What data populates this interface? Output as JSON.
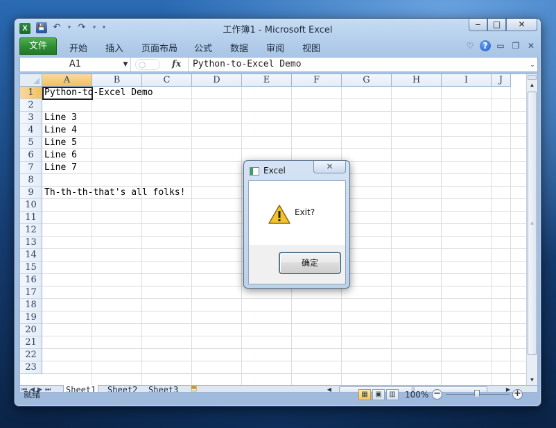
{
  "window": {
    "title": "工作簿1 - Microsoft Excel",
    "app_icon": "excel-icon",
    "caption_min": "▭",
    "caption_max": "□",
    "caption_close": "✕"
  },
  "qat": {
    "save_icon": "▪",
    "undo_icon": "↶",
    "redo_icon": "↷",
    "dropdown": "▾",
    "customize": "▾"
  },
  "ribbon": {
    "file_tab": "文件",
    "tabs": [
      "开始",
      "插入",
      "页面布局",
      "公式",
      "数据",
      "审阅",
      "视图"
    ],
    "collapse_icon": "♡",
    "help_icon": "?",
    "min_icon": "▭",
    "restore_icon": "❐",
    "close_icon": "✕"
  },
  "formula_bar": {
    "name_box": "A1",
    "fx": "fx",
    "value": "Python-to-Excel Demo"
  },
  "sheet": {
    "columns": [
      "A",
      "B",
      "C",
      "D",
      "E",
      "F",
      "G",
      "H",
      "I",
      "J"
    ],
    "rows": [
      "1",
      "2",
      "3",
      "4",
      "5",
      "6",
      "7",
      "8",
      "9",
      "10",
      "11",
      "12",
      "13",
      "14",
      "15",
      "16",
      "17",
      "18",
      "19",
      "20",
      "21",
      "22",
      "23"
    ],
    "cells": [
      {
        "row": 1,
        "text": "Python-to-Excel Demo"
      },
      {
        "row": 3,
        "text": "Line 3"
      },
      {
        "row": 4,
        "text": "Line 4"
      },
      {
        "row": 5,
        "text": "Line 5"
      },
      {
        "row": 6,
        "text": "Line 6"
      },
      {
        "row": 7,
        "text": "Line 7"
      },
      {
        "row": 9,
        "text": "Th-th-th-that's all folks!"
      }
    ],
    "tabs": [
      "Sheet1",
      "Sheet2",
      "Sheet3"
    ],
    "active_tab": "Sheet1"
  },
  "statusbar": {
    "status": "就绪",
    "zoom": "100%"
  },
  "dialog": {
    "title": "Excel",
    "message": "Exit?",
    "ok_label": "确定",
    "close_label": "✕"
  }
}
